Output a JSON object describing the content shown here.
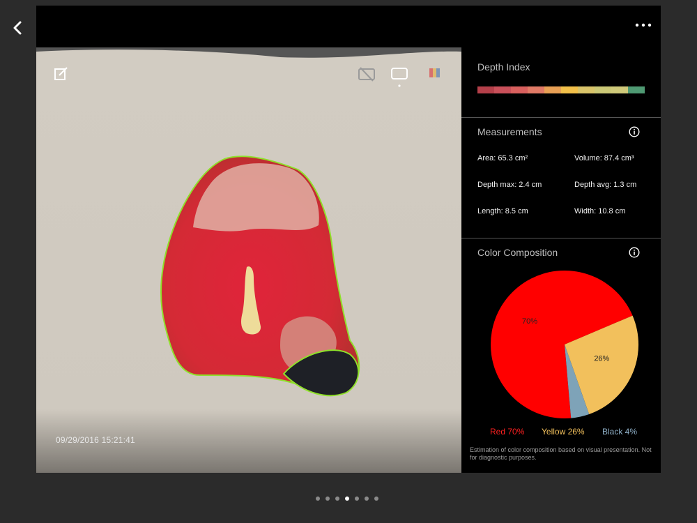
{
  "nav": {
    "back_icon": "chevron-left-icon",
    "more_icon": "ellipsis-icon"
  },
  "photo": {
    "timestamp": "09/29/2016 15:21:41",
    "tools": [
      "edit-icon",
      "hide-outline-icon",
      "outline-view-icon",
      "color-view-icon"
    ],
    "outline_color": "#8fe02a"
  },
  "depth_index": {
    "title": "Depth Index",
    "scale_colors": [
      "#b5404a",
      "#c9505a",
      "#d8605e",
      "#e07a66",
      "#e8a055",
      "#f2c04a",
      "#d9c46a",
      "#cbc876",
      "#cfc97a",
      "#4f9a73"
    ]
  },
  "measurements": {
    "title": "Measurements",
    "area": "Area: 65.3 cm²",
    "volume": "Volume: 87.4 cm³",
    "depth_max": "Depth max: 2.4 cm",
    "depth_avg": "Depth avg: 1.3 cm",
    "length": "Length: 8.5 cm",
    "width": "Width: 10.8 cm"
  },
  "color_composition": {
    "title": "Color Composition",
    "legend": {
      "red": "Red 70%",
      "yellow": "Yellow 26%",
      "black": "Black 4%"
    },
    "disclaimer": "Estimation of color composition based on visual presentation. Not for diagnostic purposes."
  },
  "chart_data": {
    "type": "pie",
    "categories": [
      "Red",
      "Yellow",
      "Black"
    ],
    "values": [
      70,
      26,
      4
    ],
    "labels": [
      "70%",
      "26%",
      ""
    ],
    "colors": [
      "#ff0000",
      "#f2c05c",
      "#7ea3b8"
    ]
  },
  "pager": {
    "count": 7,
    "active": 3
  }
}
